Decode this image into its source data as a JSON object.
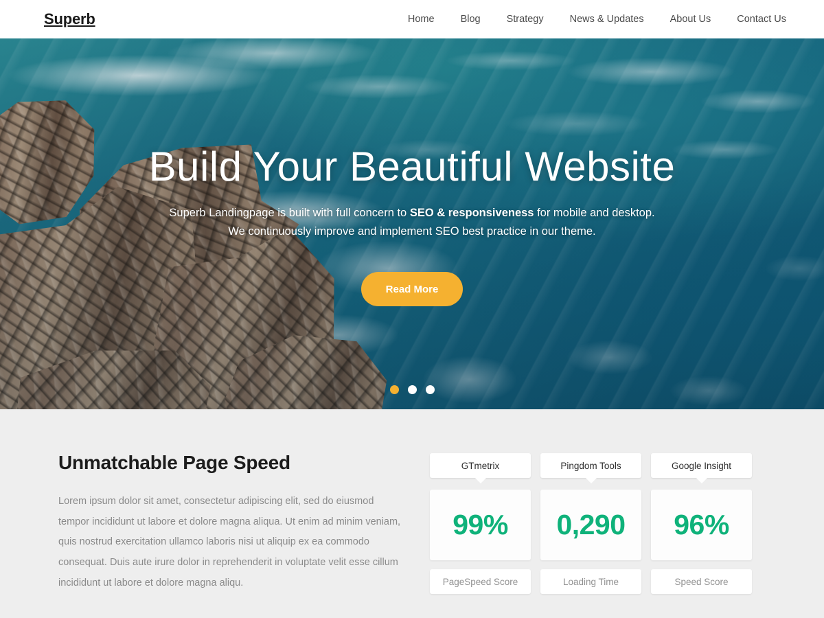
{
  "header": {
    "brand": "Superb",
    "nav": [
      {
        "label": "Home"
      },
      {
        "label": "Blog"
      },
      {
        "label": "Strategy"
      },
      {
        "label": "News & Updates"
      },
      {
        "label": "About Us"
      },
      {
        "label": "Contact Us"
      }
    ]
  },
  "hero": {
    "title": "Build Your Beautiful Website",
    "subtitle_part1": "Superb Landingpage is built with full concern to ",
    "subtitle_strong": "SEO & responsiveness",
    "subtitle_part2": " for mobile and desktop.",
    "subtitle_line2": "We continuously improve and implement SEO best practice in our theme.",
    "cta_label": "Read More",
    "accent_color": "#f5b130",
    "slides": [
      {
        "active": true
      },
      {
        "active": false
      },
      {
        "active": false
      }
    ]
  },
  "speed": {
    "heading": "Unmatchable Page Speed",
    "paragraph": "Lorem ipsum dolor sit amet, consectetur adipiscing elit, sed do eiusmod tempor incididunt ut labore et dolore magna aliqua. Ut enim ad minim veniam, quis nostrud exercitation ullamco laboris nisi ut aliquip ex ea commodo consequat. Duis aute irure dolor in reprehenderit in voluptate velit esse cillum incididunt ut labore et dolore magna aliqu.",
    "value_color": "#0fb27a",
    "metrics": [
      {
        "source": "GTmetrix",
        "value": "99%",
        "label": "PageSpeed Score"
      },
      {
        "source": "Pingdom Tools",
        "value": "0,290",
        "label": "Loading Time"
      },
      {
        "source": "Google Insight",
        "value": "96%",
        "label": "Speed Score"
      }
    ]
  }
}
